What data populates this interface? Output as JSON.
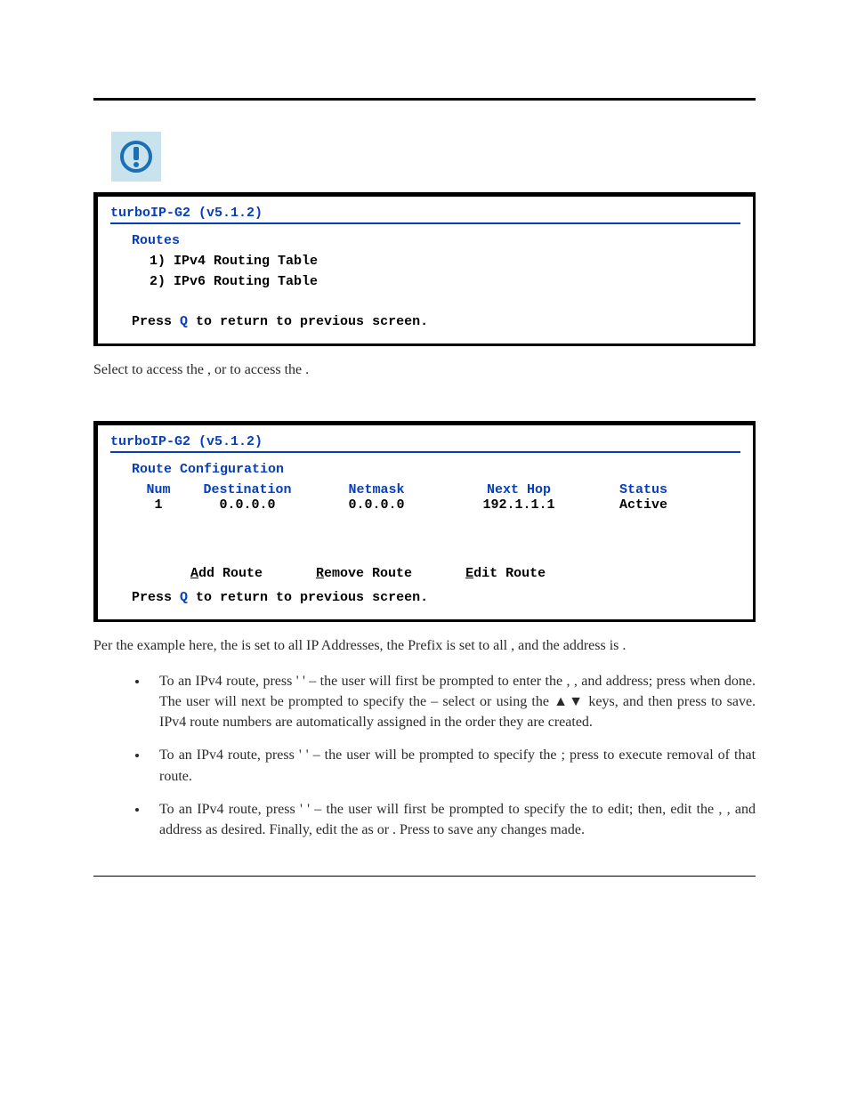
{
  "icon": "alert-icon",
  "screen1": {
    "title": "turboIP-G2 (v5.1.2)",
    "section": "Routes",
    "items": [
      "1) IPv4 Routing Table",
      "2) IPv6 Routing Table"
    ],
    "footer_pre": "Press ",
    "footer_key": "Q",
    "footer_post": " to return to previous screen."
  },
  "caption1": {
    "p1": "Select ",
    "p2": " to access the ",
    "p3": ", or ",
    "p4": " to access the ",
    "p5": "."
  },
  "screen2": {
    "title": "turboIP-G2 (v5.1.2)",
    "section": "Route Configuration",
    "headers": {
      "num": "Num",
      "dest": "Destination",
      "mask": "Netmask",
      "hop": "Next Hop",
      "status": "Status"
    },
    "row": {
      "num": "1",
      "dest": "0.0.0.0",
      "mask": "0.0.0.0",
      "hop": "192.1.1.1",
      "status": "Active"
    },
    "cmds": {
      "add_u": "A",
      "add_r": "dd Route",
      "rem_u": "R",
      "rem_r": "emove Route",
      "edit_u": "E",
      "edit_r": "dit Route"
    },
    "footer_pre": "Press ",
    "footer_key": "Q",
    "footer_post": " to return to previous screen."
  },
  "para2": {
    "p1": "Per the example here, the ",
    "p2": " is set to all IP Addresses, the Prefix is set to all ",
    "p3": ", and the ",
    "p4": " address is ",
    "p5": "."
  },
  "bullets": {
    "b1": {
      "a": "To ",
      "b": " an IPv4 route, press ' ",
      "c": " ' – the user will first be prompted to enter the ",
      "d": ", ",
      "e": ", and ",
      "f": " address; press ",
      "g": " when done. The user will next be prompted to specify the ",
      "h": " – select ",
      "i": " or ",
      "j": " using the ",
      "arrows": "▲▼",
      "k": " keys, and then press ",
      "l": " to save. IPv4 route numbers are automatically assigned in the order they are created."
    },
    "b2": {
      "a": "To ",
      "b": " an IPv4 route, press ' ",
      "c": " ' – the user will be prompted to specify the ",
      "d": "; press ",
      "e": " to execute removal of that route."
    },
    "b3": {
      "a": "To ",
      "b": " an IPv4 route, press ' ",
      "c": " ' – the user will first be prompted to specify the ",
      "d": " to edit; then, edit the ",
      "e": ", ",
      "f": ", and ",
      "g": " address as desired. Finally, edit the ",
      "h": " as ",
      "i": " or ",
      "j": ". Press ",
      "k": " to save any changes made."
    }
  }
}
